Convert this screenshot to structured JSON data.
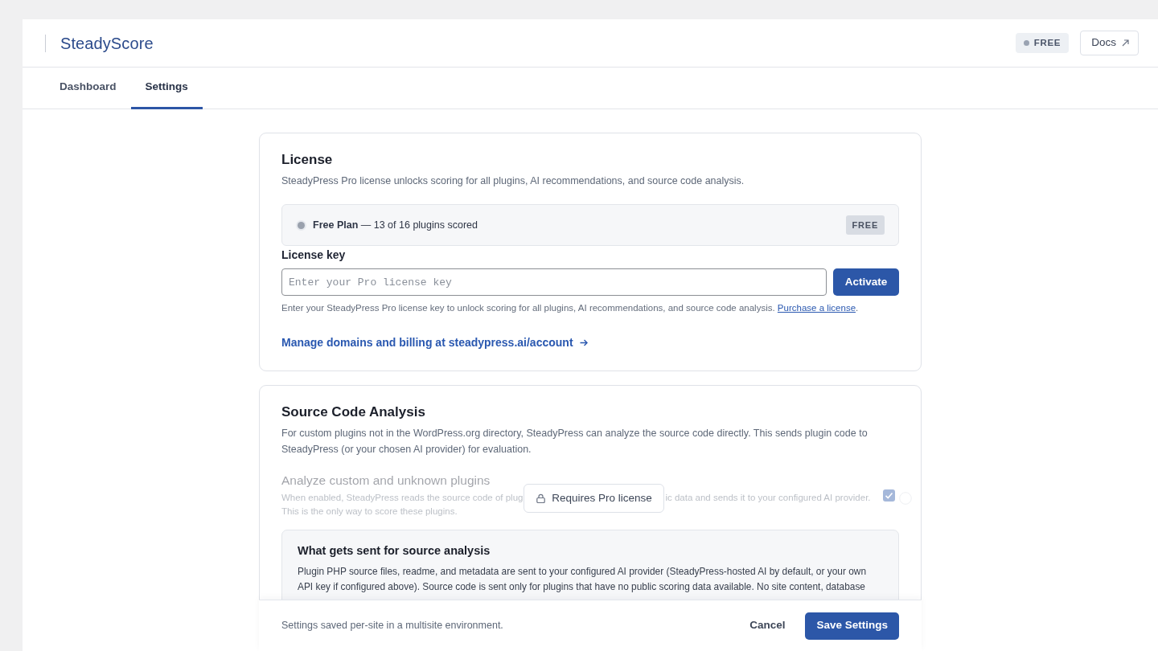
{
  "header": {
    "title": "SteadyScore",
    "plan_badge": "FREE",
    "docs_button": "Docs"
  },
  "tabs": [
    {
      "label": "Dashboard",
      "selected": false
    },
    {
      "label": "Settings",
      "selected": true
    }
  ],
  "license": {
    "title": "License",
    "description": "SteadyPress Pro license unlocks scoring for all plugins, AI recommendations, and source code analysis.",
    "plan_status": {
      "text": "**Free Plan** — 13 of 16 plugins scored",
      "badge": "FREE"
    },
    "key_field": {
      "label": "License key",
      "placeholder": "Enter your Pro license key"
    },
    "activate_button": "Activate",
    "help": {
      "text": "Enter your SteadyPress Pro license key to unlock scoring for all plugins, AI recommendations, and source code analysis.",
      "link": "Purchase a license",
      "end": "."
    },
    "account_link": "Manage domains and billing at steadypress.ai/account"
  },
  "source_analysis": {
    "title": "Source Code Analysis",
    "description": "For custom plugins not in the WordPress.org directory, SteadyPress can analyze the source code directly. This sends plugin code to SteadyPress (or your chosen AI provider) for evaluation.",
    "setting": {
      "label": "Analyze custom and unknown plugins",
      "description_parts": [
        "When enabled, SteadyPress reads the source code of plug",
        "ic data and sends it to your configured AI provider.",
        "This is the only way to score these plugins."
      ],
      "checked": true,
      "disabled": true,
      "lock_notice": "Requires Pro license"
    },
    "info_box": {
      "title": "What gets sent for source analysis",
      "text": "Plugin PHP source files, readme, and metadata are sent to your configured AI provider (SteadyPress-hosted AI by default, or your own API key if configured above). Source code is sent only for plugins that have no public scoring data available. No site content, database"
    }
  },
  "footer": {
    "note": "Settings saved per-site in a multisite environment.",
    "cancel_button": "Cancel",
    "save_button": "Save Settings"
  }
}
